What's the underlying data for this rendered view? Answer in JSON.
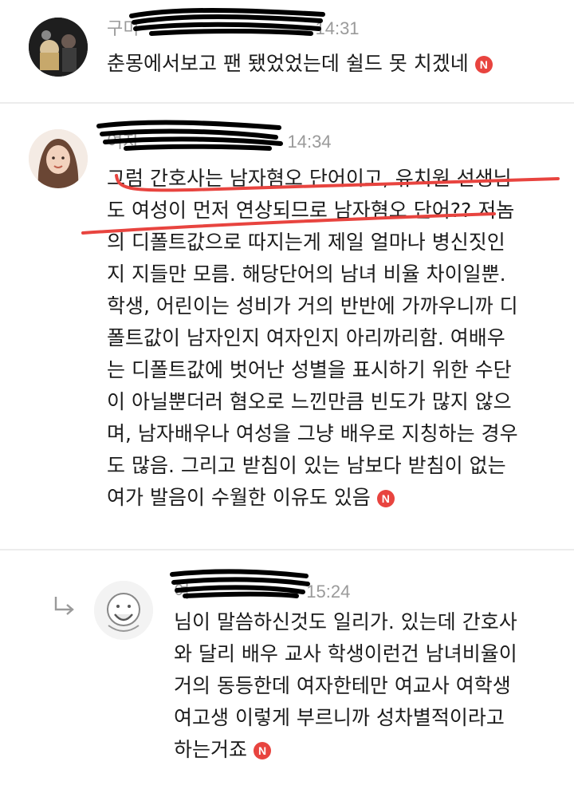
{
  "comments": [
    {
      "author": "구미",
      "time": "14:31",
      "text": "춘몽에서보고 팬 됐었었는데 쉴드 못 치겠네",
      "badge": "N"
    },
    {
      "author": "여자",
      "time": "14:34",
      "lines": [
        "그럼 간호사는 남자혐오 단어이고, 유치원 선생님",
        "도 여성이 먼저 연상되므로 남자혐오 단어?? 저놈",
        "의 디폴트값으로 따지는게 제일 얼마나 병신짓인",
        "지 지들만 모름. 해당단어의 남녀 비율 차이일뿐.",
        "학생, 어린이는 성비가 거의 반반에 가까우니까 디",
        "폴트값이 남자인지 여자인지 아리까리함. 여배우",
        "는 디폴트값에 벗어난 성별을 표시하기 위한 수단",
        "이 아닐뿐더러 혐오로 느낀만큼 빈도가 많지 않으",
        "며, 남자배우나 여성을 그냥 배우로 지칭하는 경우",
        "도 많음. 그리고 받침이 있는 남보다 받침이 없는",
        "여가 발음이 수월한 이유도 있음"
      ],
      "badge": "N"
    },
    {
      "author": "여",
      "time": "15:24",
      "lines": [
        "님이 말씀하신것도 일리가. 있는데 간호사",
        "와 달리 배우 교사 학생이런건 남녀비율이",
        "거의 동등한데 여자한테만 여교사 여학생",
        "여고생 이렇게 부르니까 성차별적이라고",
        "하는거죠"
      ],
      "badge": "N",
      "reply_icon": "reply-arrow-icon"
    }
  ],
  "colors": {
    "badge": "#e8443f",
    "underline": "#e8443f",
    "meta": "#9a9a9a",
    "divider": "#ececec"
  }
}
